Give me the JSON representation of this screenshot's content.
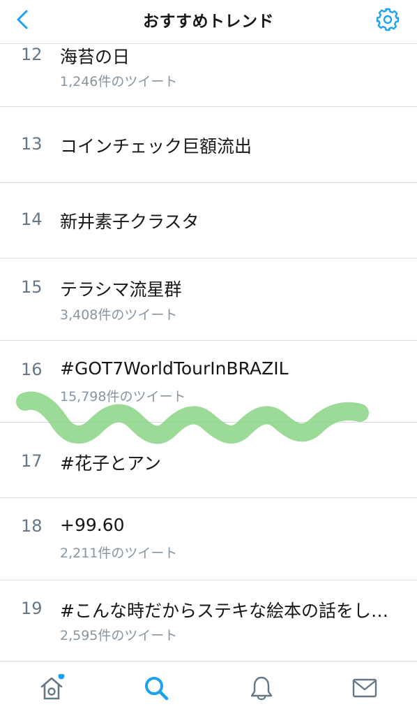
{
  "header": {
    "title": "おすすめトレンド",
    "back_icon": "chevron-left-icon",
    "settings_icon": "gear-icon",
    "accent_color": "#1da1f2"
  },
  "trends": [
    {
      "rank": "12",
      "name": "海苔の日",
      "count": "1,246件のツイート"
    },
    {
      "rank": "13",
      "name": "コインチェック巨額流出",
      "count": ""
    },
    {
      "rank": "14",
      "name": "新井素子クラスタ",
      "count": ""
    },
    {
      "rank": "15",
      "name": "テラシマ流星群",
      "count": "3,408件のツイート"
    },
    {
      "rank": "16",
      "name": "#GOT7WorldTourInBRAZIL",
      "count": "15,798件のツイート"
    },
    {
      "rank": "17",
      "name": "#花子とアン",
      "count": ""
    },
    {
      "rank": "18",
      "name": "+99.60",
      "count": "2,211件のツイート"
    },
    {
      "rank": "19",
      "name": "#こんな時だからステキな絵本の話をし…",
      "count": "2,595件のツイート"
    }
  ],
  "annotation": {
    "type": "green-wavy-highlight",
    "color": "#7fd17a"
  },
  "tabbar": {
    "items": [
      {
        "icon": "home-icon",
        "active": false,
        "has_badge": true
      },
      {
        "icon": "search-icon",
        "active": true,
        "has_badge": false
      },
      {
        "icon": "bell-icon",
        "active": false,
        "has_badge": false
      },
      {
        "icon": "mail-icon",
        "active": false,
        "has_badge": false
      }
    ],
    "active_color": "#1da1f2",
    "inactive_color": "#657786"
  }
}
